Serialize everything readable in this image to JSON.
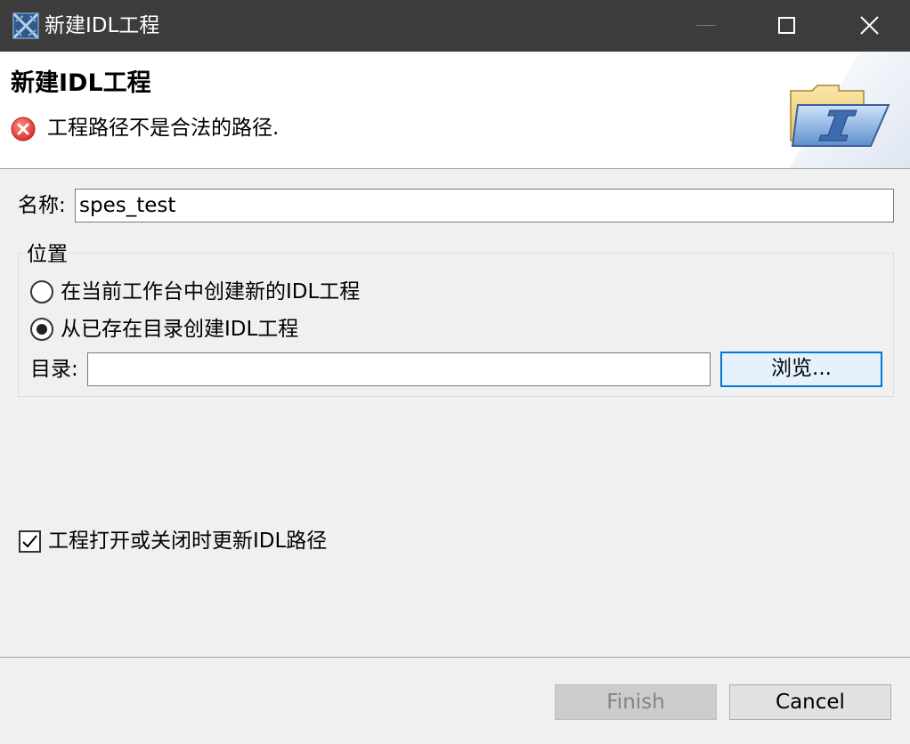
{
  "window": {
    "title": "新建IDL工程",
    "controls": [
      "minimize",
      "maximize",
      "close"
    ]
  },
  "header": {
    "title": "新建IDL工程",
    "error_message": "工程路径不是合法的路径.",
    "error_icon": "error-icon",
    "image_icon": "idl-folder-icon"
  },
  "form": {
    "name_label": "名称:",
    "name_value": "spes_test",
    "location": {
      "group_label": "位置",
      "options": [
        {
          "label": "在当前工作台中创建新的IDL工程",
          "selected": false
        },
        {
          "label": "从已存在目录创建IDL工程",
          "selected": true
        }
      ],
      "dir_label": "目录:",
      "dir_value": "",
      "browse_label": "浏览..."
    },
    "update_path": {
      "label": "工程打开或关闭时更新IDL路径",
      "checked": true
    }
  },
  "footer": {
    "finish_label": "Finish",
    "finish_enabled": false,
    "cancel_label": "Cancel"
  },
  "colors": {
    "titlebar": "#3c3c3c",
    "error_red": "#e0413d",
    "focus_blue": "#0078d7"
  }
}
